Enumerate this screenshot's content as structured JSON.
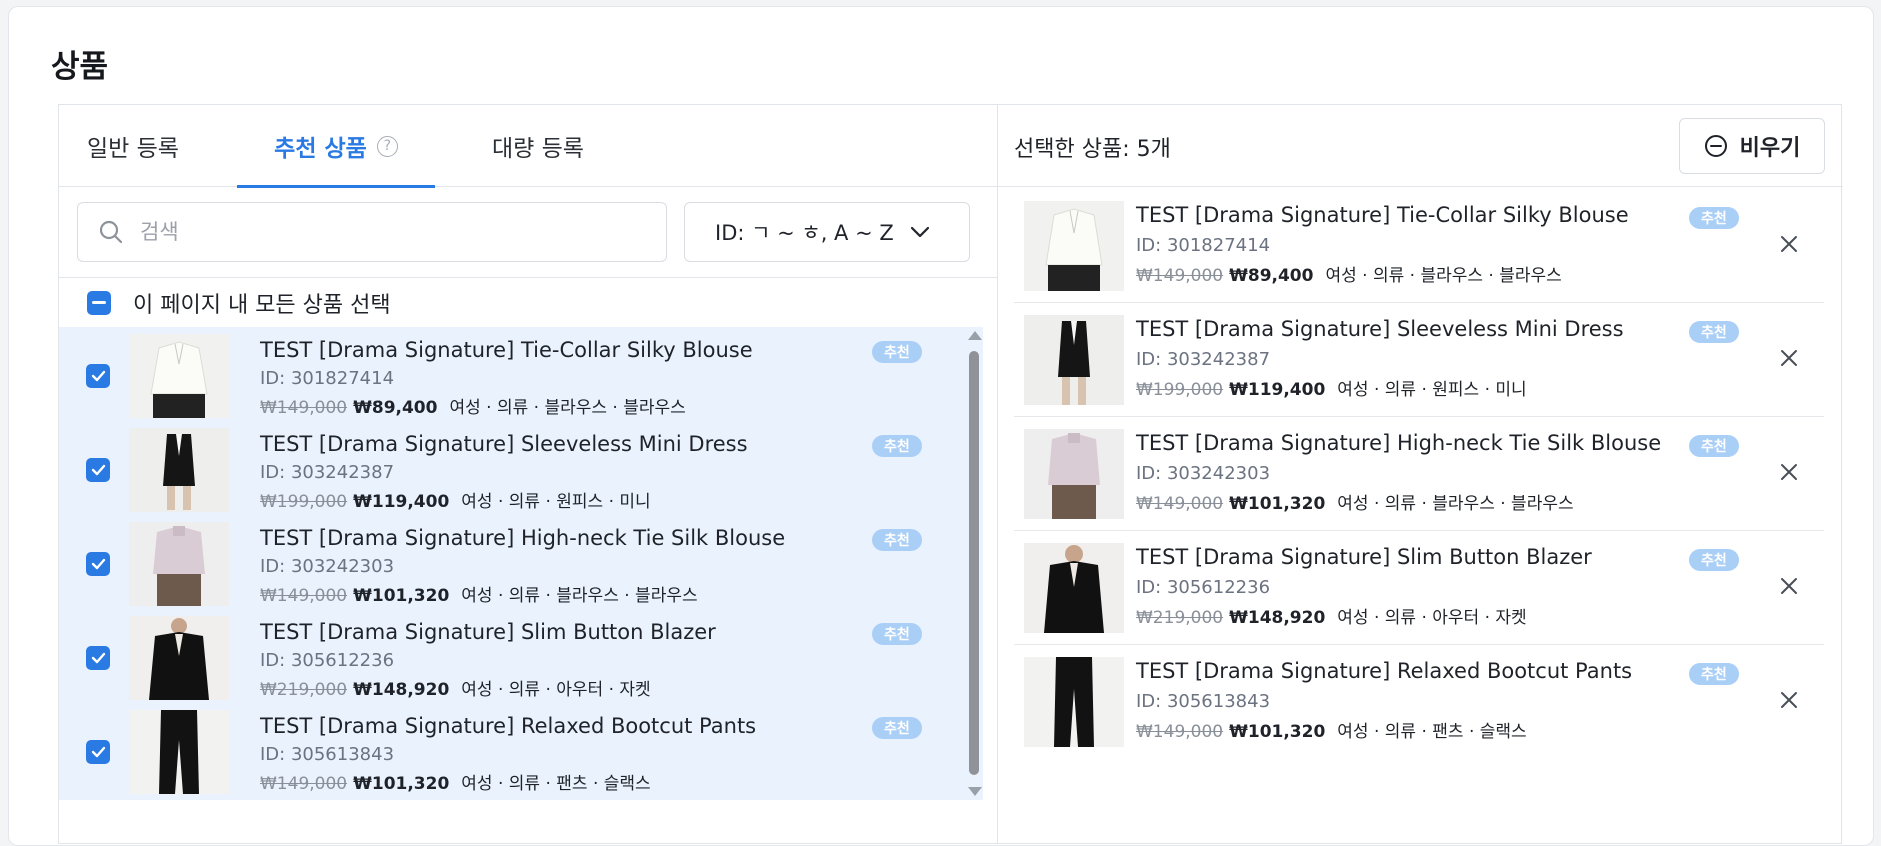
{
  "page": {
    "title": "상품"
  },
  "tabs": [
    {
      "label": "일반 등록"
    },
    {
      "label": "추천 상품",
      "help": "?"
    },
    {
      "label": "대량 등록"
    }
  ],
  "search": {
    "placeholder": "검색",
    "value": ""
  },
  "sort": {
    "label": "ID: ㄱ ~ ㅎ, A ~ Z"
  },
  "select_all": {
    "label": "이 페이지 내 모든 상품 선택",
    "state": "indeterminate"
  },
  "products": [
    {
      "title": "TEST [Drama Signature] Tie-Collar Silky Blouse",
      "id": "ID: 301827414",
      "original_price": "₩149,000",
      "sale_price": "₩89,400",
      "category": "여성 · 의류 · 블라우스 · 블라우스",
      "badge": "추천",
      "checked": true,
      "thumb": "white-blouse"
    },
    {
      "title": "TEST [Drama Signature] Sleeveless Mini Dress",
      "id": "ID: 303242387",
      "original_price": "₩199,000",
      "sale_price": "₩119,400",
      "category": "여성 · 의류 · 원피스 · 미니",
      "badge": "추천",
      "checked": true,
      "thumb": "black-mini-dress"
    },
    {
      "title": "TEST [Drama Signature] High-neck Tie Silk Blouse",
      "id": "ID: 303242303",
      "original_price": "₩149,000",
      "sale_price": "₩101,320",
      "category": "여성 · 의류 · 블라우스 · 블라우스",
      "badge": "추천",
      "checked": true,
      "thumb": "lilac-blouse"
    },
    {
      "title": "TEST [Drama Signature] Slim Button Blazer",
      "id": "ID: 305612236",
      "original_price": "₩219,000",
      "sale_price": "₩148,920",
      "category": "여성 · 의류 · 아우터 · 자켓",
      "badge": "추천",
      "checked": true,
      "thumb": "black-blazer"
    },
    {
      "title": "TEST [Drama Signature] Relaxed Bootcut Pants",
      "id": "ID: 305613843",
      "original_price": "₩149,000",
      "sale_price": "₩101,320",
      "category": "여성 · 의류 · 팬츠 · 슬랙스",
      "badge": "추천",
      "checked": true,
      "thumb": "black-pants"
    }
  ],
  "selected": {
    "count_label": "선택한 상품: 5개",
    "clear_label": "비우기",
    "items": [
      {
        "title": "TEST [Drama Signature] Tie-Collar Silky Blouse",
        "id": "ID: 301827414",
        "original_price": "₩149,000",
        "sale_price": "₩89,400",
        "category": "여성 · 의류 · 블라우스 · 블라우스",
        "badge": "추천"
      },
      {
        "title": "TEST [Drama Signature] Sleeveless Mini Dress",
        "id": "ID: 303242387",
        "original_price": "₩199,000",
        "sale_price": "₩119,400",
        "category": "여성 · 의류 · 원피스 · 미니",
        "badge": "추천"
      },
      {
        "title": "TEST [Drama Signature] High-neck Tie Silk Blouse",
        "id": "ID: 303242303",
        "original_price": "₩149,000",
        "sale_price": "₩101,320",
        "category": "여성 · 의류 · 블라우스 · 블라우스",
        "badge": "추천"
      },
      {
        "title": "TEST [Drama Signature] Slim Button Blazer",
        "id": "ID: 305612236",
        "original_price": "₩219,000",
        "sale_price": "₩148,920",
        "category": "여성 · 의류 · 아우터 · 자켓",
        "badge": "추천"
      },
      {
        "title": "TEST [Drama Signature] Relaxed Bootcut Pants",
        "id": "ID: 305613843",
        "original_price": "₩149,000",
        "sale_price": "₩101,320",
        "category": "여성 · 의류 · 팬츠 · 슬랙스",
        "badge": "추천"
      }
    ]
  },
  "icons": {
    "search": "search-icon",
    "sort": "chevron-down-icon",
    "clear": "minus-circle-icon",
    "remove": "close-icon",
    "help": "question-circle-icon"
  },
  "colors": {
    "accent": "#2a7ae4",
    "list_bg": "#e9f2fd",
    "badge_bg": "#aacff6"
  }
}
